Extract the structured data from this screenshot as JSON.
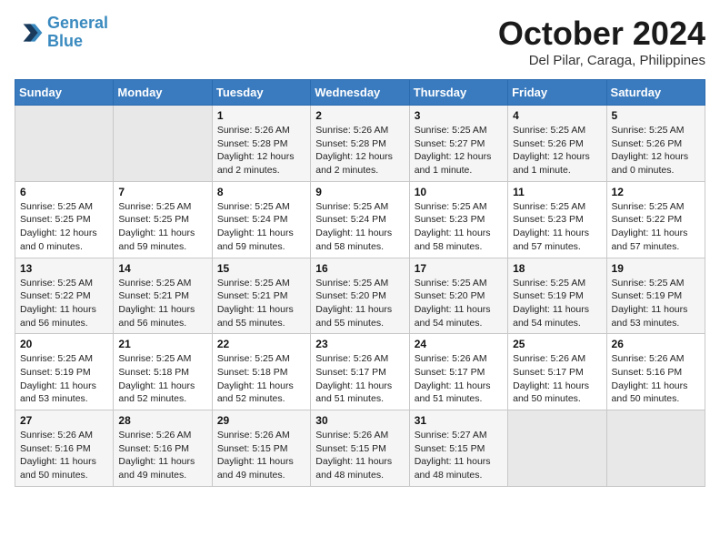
{
  "header": {
    "logo_line1": "General",
    "logo_line2": "Blue",
    "month": "October 2024",
    "location": "Del Pilar, Caraga, Philippines"
  },
  "weekdays": [
    "Sunday",
    "Monday",
    "Tuesday",
    "Wednesday",
    "Thursday",
    "Friday",
    "Saturday"
  ],
  "weeks": [
    [
      {
        "day": "",
        "sunrise": "",
        "sunset": "",
        "daylight": ""
      },
      {
        "day": "",
        "sunrise": "",
        "sunset": "",
        "daylight": ""
      },
      {
        "day": "1",
        "sunrise": "Sunrise: 5:26 AM",
        "sunset": "Sunset: 5:28 PM",
        "daylight": "Daylight: 12 hours and 2 minutes."
      },
      {
        "day": "2",
        "sunrise": "Sunrise: 5:26 AM",
        "sunset": "Sunset: 5:28 PM",
        "daylight": "Daylight: 12 hours and 2 minutes."
      },
      {
        "day": "3",
        "sunrise": "Sunrise: 5:25 AM",
        "sunset": "Sunset: 5:27 PM",
        "daylight": "Daylight: 12 hours and 1 minute."
      },
      {
        "day": "4",
        "sunrise": "Sunrise: 5:25 AM",
        "sunset": "Sunset: 5:26 PM",
        "daylight": "Daylight: 12 hours and 1 minute."
      },
      {
        "day": "5",
        "sunrise": "Sunrise: 5:25 AM",
        "sunset": "Sunset: 5:26 PM",
        "daylight": "Daylight: 12 hours and 0 minutes."
      }
    ],
    [
      {
        "day": "6",
        "sunrise": "Sunrise: 5:25 AM",
        "sunset": "Sunset: 5:25 PM",
        "daylight": "Daylight: 12 hours and 0 minutes."
      },
      {
        "day": "7",
        "sunrise": "Sunrise: 5:25 AM",
        "sunset": "Sunset: 5:25 PM",
        "daylight": "Daylight: 11 hours and 59 minutes."
      },
      {
        "day": "8",
        "sunrise": "Sunrise: 5:25 AM",
        "sunset": "Sunset: 5:24 PM",
        "daylight": "Daylight: 11 hours and 59 minutes."
      },
      {
        "day": "9",
        "sunrise": "Sunrise: 5:25 AM",
        "sunset": "Sunset: 5:24 PM",
        "daylight": "Daylight: 11 hours and 58 minutes."
      },
      {
        "day": "10",
        "sunrise": "Sunrise: 5:25 AM",
        "sunset": "Sunset: 5:23 PM",
        "daylight": "Daylight: 11 hours and 58 minutes."
      },
      {
        "day": "11",
        "sunrise": "Sunrise: 5:25 AM",
        "sunset": "Sunset: 5:23 PM",
        "daylight": "Daylight: 11 hours and 57 minutes."
      },
      {
        "day": "12",
        "sunrise": "Sunrise: 5:25 AM",
        "sunset": "Sunset: 5:22 PM",
        "daylight": "Daylight: 11 hours and 57 minutes."
      }
    ],
    [
      {
        "day": "13",
        "sunrise": "Sunrise: 5:25 AM",
        "sunset": "Sunset: 5:22 PM",
        "daylight": "Daylight: 11 hours and 56 minutes."
      },
      {
        "day": "14",
        "sunrise": "Sunrise: 5:25 AM",
        "sunset": "Sunset: 5:21 PM",
        "daylight": "Daylight: 11 hours and 56 minutes."
      },
      {
        "day": "15",
        "sunrise": "Sunrise: 5:25 AM",
        "sunset": "Sunset: 5:21 PM",
        "daylight": "Daylight: 11 hours and 55 minutes."
      },
      {
        "day": "16",
        "sunrise": "Sunrise: 5:25 AM",
        "sunset": "Sunset: 5:20 PM",
        "daylight": "Daylight: 11 hours and 55 minutes."
      },
      {
        "day": "17",
        "sunrise": "Sunrise: 5:25 AM",
        "sunset": "Sunset: 5:20 PM",
        "daylight": "Daylight: 11 hours and 54 minutes."
      },
      {
        "day": "18",
        "sunrise": "Sunrise: 5:25 AM",
        "sunset": "Sunset: 5:19 PM",
        "daylight": "Daylight: 11 hours and 54 minutes."
      },
      {
        "day": "19",
        "sunrise": "Sunrise: 5:25 AM",
        "sunset": "Sunset: 5:19 PM",
        "daylight": "Daylight: 11 hours and 53 minutes."
      }
    ],
    [
      {
        "day": "20",
        "sunrise": "Sunrise: 5:25 AM",
        "sunset": "Sunset: 5:19 PM",
        "daylight": "Daylight: 11 hours and 53 minutes."
      },
      {
        "day": "21",
        "sunrise": "Sunrise: 5:25 AM",
        "sunset": "Sunset: 5:18 PM",
        "daylight": "Daylight: 11 hours and 52 minutes."
      },
      {
        "day": "22",
        "sunrise": "Sunrise: 5:25 AM",
        "sunset": "Sunset: 5:18 PM",
        "daylight": "Daylight: 11 hours and 52 minutes."
      },
      {
        "day": "23",
        "sunrise": "Sunrise: 5:26 AM",
        "sunset": "Sunset: 5:17 PM",
        "daylight": "Daylight: 11 hours and 51 minutes."
      },
      {
        "day": "24",
        "sunrise": "Sunrise: 5:26 AM",
        "sunset": "Sunset: 5:17 PM",
        "daylight": "Daylight: 11 hours and 51 minutes."
      },
      {
        "day": "25",
        "sunrise": "Sunrise: 5:26 AM",
        "sunset": "Sunset: 5:17 PM",
        "daylight": "Daylight: 11 hours and 50 minutes."
      },
      {
        "day": "26",
        "sunrise": "Sunrise: 5:26 AM",
        "sunset": "Sunset: 5:16 PM",
        "daylight": "Daylight: 11 hours and 50 minutes."
      }
    ],
    [
      {
        "day": "27",
        "sunrise": "Sunrise: 5:26 AM",
        "sunset": "Sunset: 5:16 PM",
        "daylight": "Daylight: 11 hours and 50 minutes."
      },
      {
        "day": "28",
        "sunrise": "Sunrise: 5:26 AM",
        "sunset": "Sunset: 5:16 PM",
        "daylight": "Daylight: 11 hours and 49 minutes."
      },
      {
        "day": "29",
        "sunrise": "Sunrise: 5:26 AM",
        "sunset": "Sunset: 5:15 PM",
        "daylight": "Daylight: 11 hours and 49 minutes."
      },
      {
        "day": "30",
        "sunrise": "Sunrise: 5:26 AM",
        "sunset": "Sunset: 5:15 PM",
        "daylight": "Daylight: 11 hours and 48 minutes."
      },
      {
        "day": "31",
        "sunrise": "Sunrise: 5:27 AM",
        "sunset": "Sunset: 5:15 PM",
        "daylight": "Daylight: 11 hours and 48 minutes."
      },
      {
        "day": "",
        "sunrise": "",
        "sunset": "",
        "daylight": ""
      },
      {
        "day": "",
        "sunrise": "",
        "sunset": "",
        "daylight": ""
      }
    ]
  ]
}
